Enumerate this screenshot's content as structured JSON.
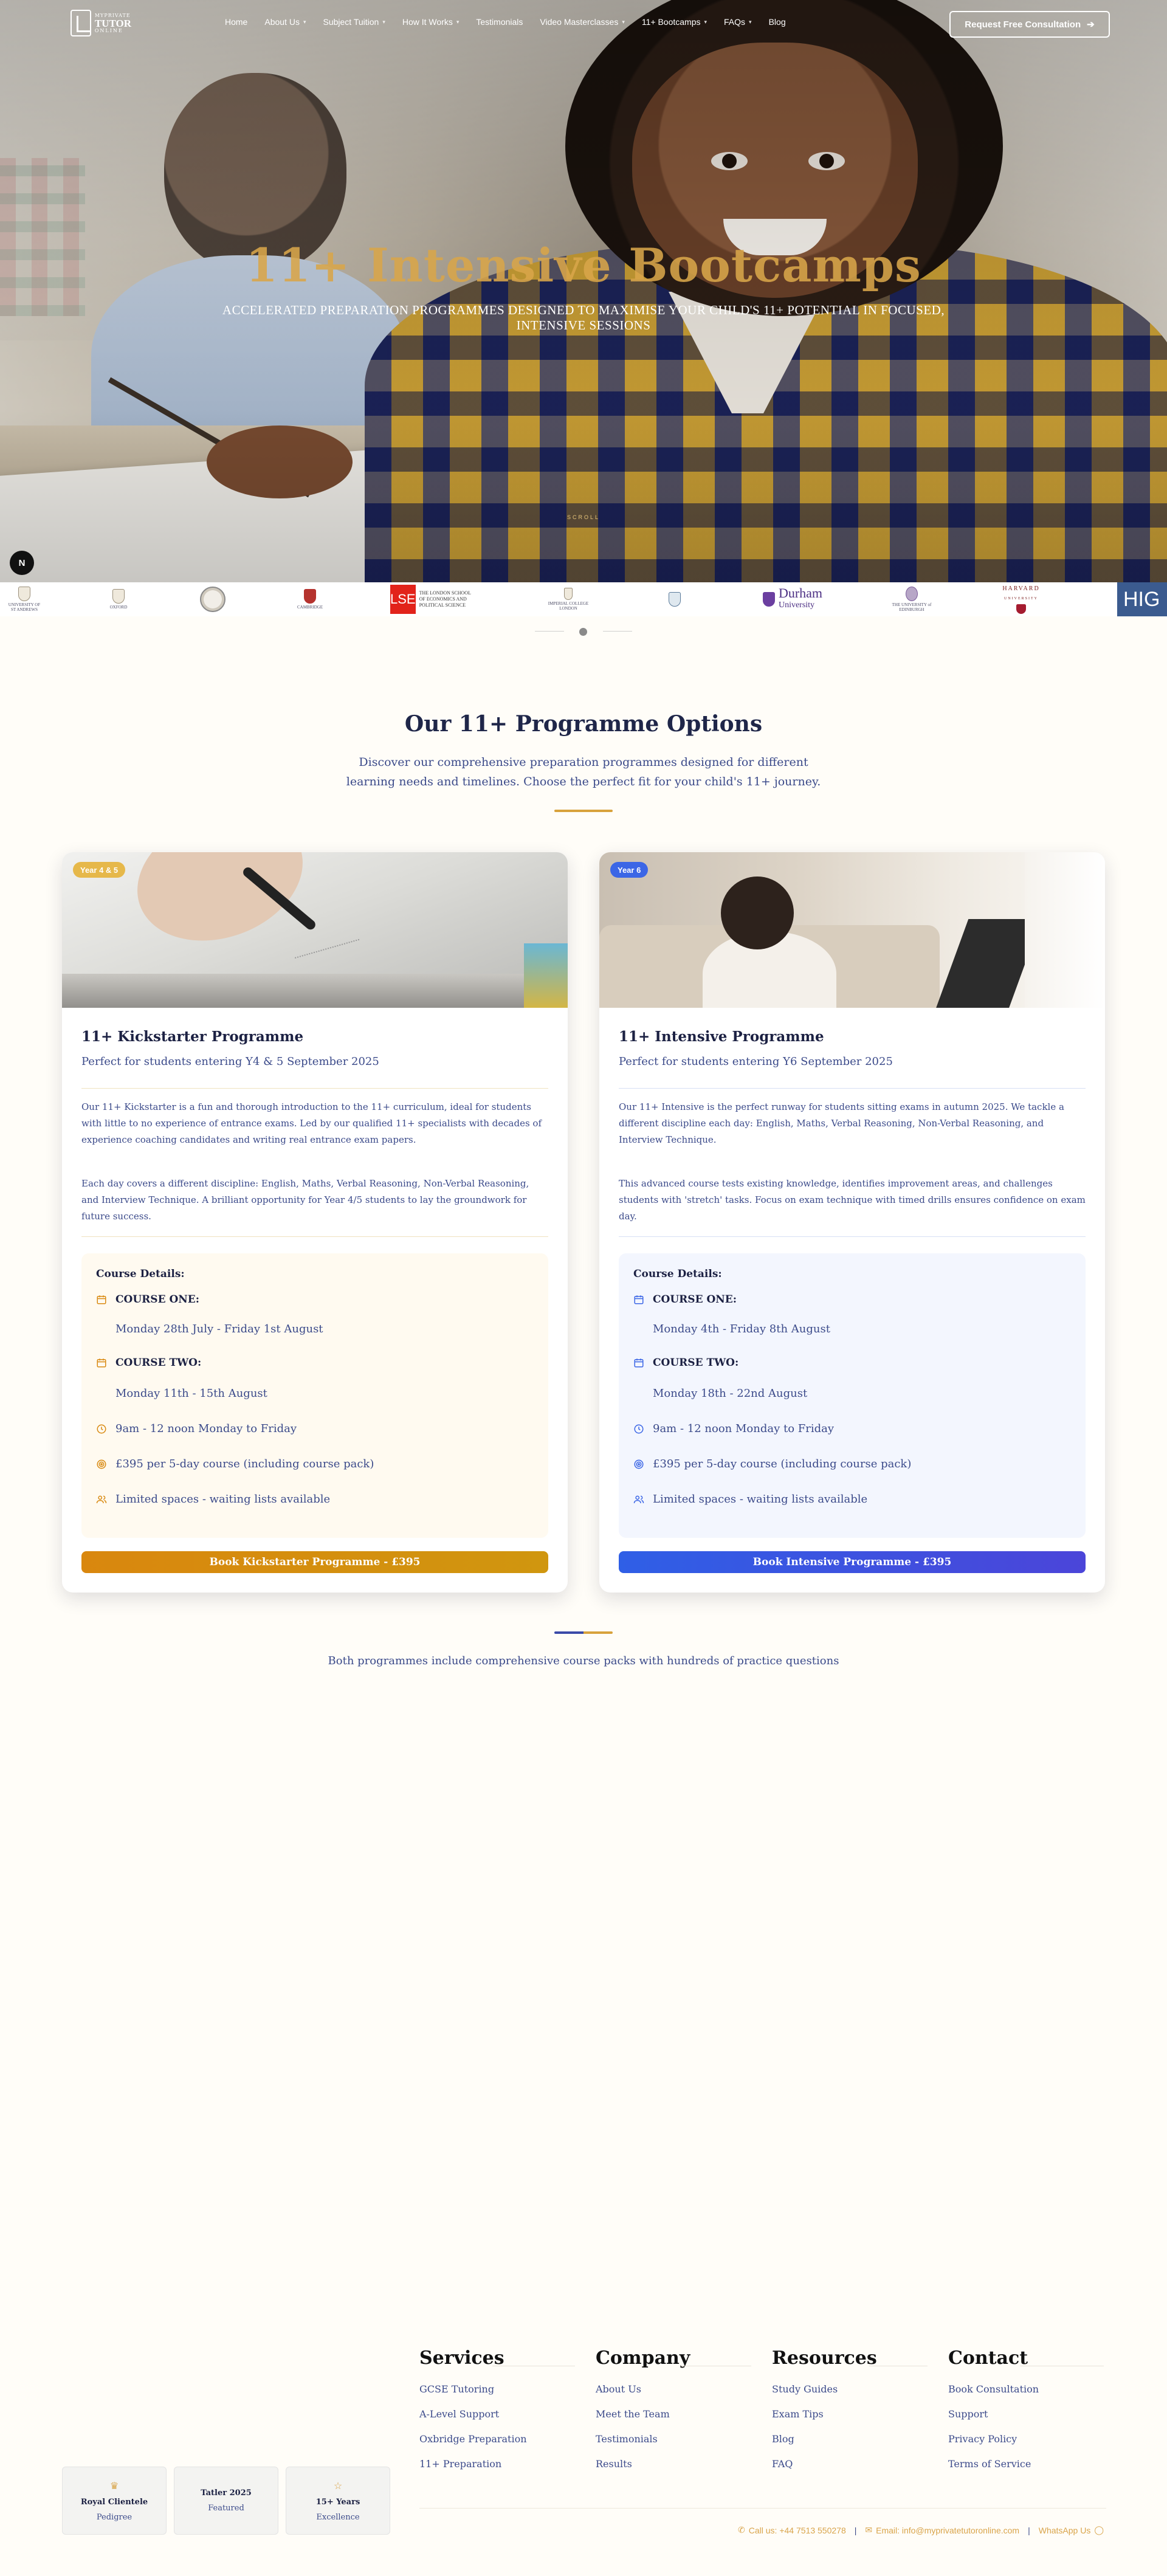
{
  "nav": {
    "logo_lines": [
      "MYPRIVATE",
      "TUTOR",
      "ONLINE"
    ],
    "items": [
      {
        "label": "Home",
        "dropdown": false
      },
      {
        "label": "About Us",
        "dropdown": true
      },
      {
        "label": "Subject Tuition",
        "dropdown": true
      },
      {
        "label": "How It Works",
        "dropdown": true
      },
      {
        "label": "Testimonials",
        "dropdown": false
      },
      {
        "label": "Video Masterclasses",
        "dropdown": true
      },
      {
        "label": "11+ Bootcamps",
        "dropdown": true
      },
      {
        "label": "FAQs",
        "dropdown": true
      },
      {
        "label": "Blog",
        "dropdown": false
      }
    ],
    "cta_label": "Request Free Consultation",
    "cta_icon": "arrow-right-icon"
  },
  "hero": {
    "title": "11+ Intensive Bootcamps",
    "subtitle": "ACCELERATED PREPARATION PROGRAMMES DESIGNED TO MAXIMISE YOUR CHILD'S 11+ POTENTIAL IN FOCUSED, INTENSIVE SESSIONS",
    "scroll_label": "SCROLL",
    "badge_letter": "N"
  },
  "universities": {
    "items": [
      {
        "name": "St Andrews",
        "text": "UNIVERSITY OF ST ANDREWS"
      },
      {
        "name": "Oxford",
        "text": "OXFORD"
      },
      {
        "name": "Crest",
        "text": ""
      },
      {
        "name": "Cambridge",
        "text": "CAMBRIDGE"
      },
      {
        "name": "LSE",
        "text": "THE LONDON SCHOOL OF ECONOMICS AND POLITICAL SCIENCE"
      },
      {
        "name": "Imperial",
        "text": "IMPERIAL COLLEGE LONDON"
      },
      {
        "name": "Durham",
        "text": "Durham",
        "sub": "University"
      },
      {
        "name": "Edinburgh",
        "text": "THE UNIVERSITY of EDINBURGH"
      },
      {
        "name": "Harvard",
        "text": "HARVARD"
      },
      {
        "name": "HIG",
        "text": "HIG"
      }
    ],
    "lse_mark": "LSE",
    "harvard_sub": "UNIVERSITY"
  },
  "programmes": {
    "title": "Our 11+ Programme Options",
    "intro": "Discover our comprehensive preparation programmes designed for different learning needs and timelines. Choose the perfect fit for your child's 11+ journey.",
    "details_heading": "Course Details:",
    "cards": [
      {
        "badge": "Year 4 & 5",
        "title": "11+ Kickstarter Programme",
        "subtitle": "Perfect for students entering Y4 & 5 September 2025",
        "para1": "Our 11+ Kickstarter is a fun and thorough introduction to the 11+ curriculum, ideal for students with little to no experience of entrance exams. Led by our qualified 11+ specialists with decades of experience coaching candidates and writing real entrance exam papers.",
        "para2": "Each day covers a different discipline: English, Maths, Verbal Reasoning, Non-Verbal Reasoning, and Interview Technique. A brilliant opportunity for Year 4/5 students to lay the groundwork for future success.",
        "course_one_label": "COURSE ONE:",
        "course_one_dates": "Monday 28th July - Friday 1st August",
        "course_two_label": "COURSE TWO:",
        "course_two_dates": "Monday 11th - 15th August",
        "time": "9am - 12 noon Monday to Friday",
        "price": "£395 per 5-day course (including course pack)",
        "spaces": "Limited spaces - waiting lists available",
        "button": "Book Kickstarter Programme - £395",
        "accent": "#d98a12"
      },
      {
        "badge": "Year 6",
        "title": "11+ Intensive Programme",
        "subtitle": "Perfect for students entering Y6 September 2025",
        "para1": "Our 11+ Intensive is the perfect runway for students sitting exams in autumn 2025. We tackle a different discipline each day: English, Maths, Verbal Reasoning, Non-Verbal Reasoning, and Interview Technique.",
        "para2": "This advanced course tests existing knowledge, identifies improvement areas, and challenges students with 'stretch' tasks. Focus on exam technique with timed drills ensures confidence on exam day.",
        "course_one_label": "COURSE ONE:",
        "course_one_dates": "Monday 4th - Friday 8th August",
        "course_two_label": "COURSE TWO:",
        "course_two_dates": "Monday 18th - 22nd August",
        "time": "9am - 12 noon Monday to Friday",
        "price": "£395 per 5-day course (including course pack)",
        "spaces": "Limited spaces - waiting lists available",
        "button": "Book Intensive Programme - £395",
        "accent": "#3b66e6"
      }
    ],
    "footnote": "Both programmes include comprehensive course packs with hundreds of practice questions"
  },
  "footer": {
    "columns": [
      {
        "title": "Services",
        "links": [
          "GCSE Tutoring",
          "A-Level Support",
          "Oxbridge Preparation",
          "11+ Preparation"
        ]
      },
      {
        "title": "Company",
        "links": [
          "About Us",
          "Meet the Team",
          "Testimonials",
          "Results"
        ]
      },
      {
        "title": "Resources",
        "links": [
          "Study Guides",
          "Exam Tips",
          "Blog",
          "FAQ"
        ]
      },
      {
        "title": "Contact",
        "links": [
          "Book Consultation",
          "Support",
          "Privacy Policy",
          "Terms of Service"
        ]
      }
    ],
    "tiles": [
      {
        "icon": "crown-icon",
        "title": "Royal Clientele",
        "sub": "Pedigree"
      },
      {
        "icon": "award-icon",
        "title": "Tatler 2025",
        "sub": "Featured"
      },
      {
        "icon": "star-icon",
        "title": "15+ Years",
        "sub": "Excellence"
      }
    ],
    "phone": "Call us: +44 7513 550278",
    "email": "Email: info@myprivatetutoronline.com",
    "whatsapp": "WhatsApp Us"
  }
}
